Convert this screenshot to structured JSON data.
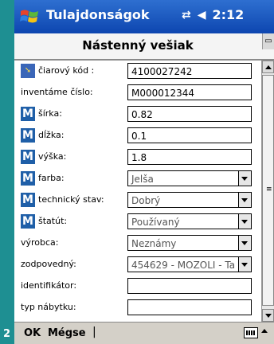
{
  "side_number": "2",
  "titlebar": {
    "app_title": "Tulajdonságok",
    "time": "2:12"
  },
  "header": {
    "title": "Nástenný vešiak"
  },
  "form": {
    "rows": [
      {
        "label": "čiarový kód :",
        "value": "4100027242",
        "type": "text",
        "icon": "barcode-icon"
      },
      {
        "label": "inventáme číslo:",
        "value": "M000012344",
        "type": "text",
        "icon": ""
      },
      {
        "label": "šírka:",
        "value": "0.82",
        "type": "text",
        "icon": "M"
      },
      {
        "label": "dĺžka:",
        "value": "0.1",
        "type": "text",
        "icon": "M"
      },
      {
        "label": "výška:",
        "value": "1.8",
        "type": "text",
        "icon": "M"
      },
      {
        "label": "farba:",
        "value": "Jelša",
        "type": "dropdown",
        "icon": "M"
      },
      {
        "label": "technický stav:",
        "value": "Dobrý",
        "type": "dropdown",
        "icon": "M"
      },
      {
        "label": "štatút:",
        "value": "Používaný",
        "type": "dropdown",
        "icon": "M"
      },
      {
        "label": "výrobca:",
        "value": "Neznámy",
        "type": "dropdown",
        "icon": ""
      },
      {
        "label": "zodpovedný:",
        "value": "454629 - MOZOLI - Ta",
        "type": "dropdown",
        "icon": ""
      },
      {
        "label": "identifikátor:",
        "value": "",
        "type": "text",
        "icon": ""
      },
      {
        "label": "typ nábytku:",
        "value": "",
        "type": "text",
        "icon": ""
      }
    ]
  },
  "menubar": {
    "ok_label": "OK",
    "cancel_label": "Mégse",
    "separator": "|"
  }
}
